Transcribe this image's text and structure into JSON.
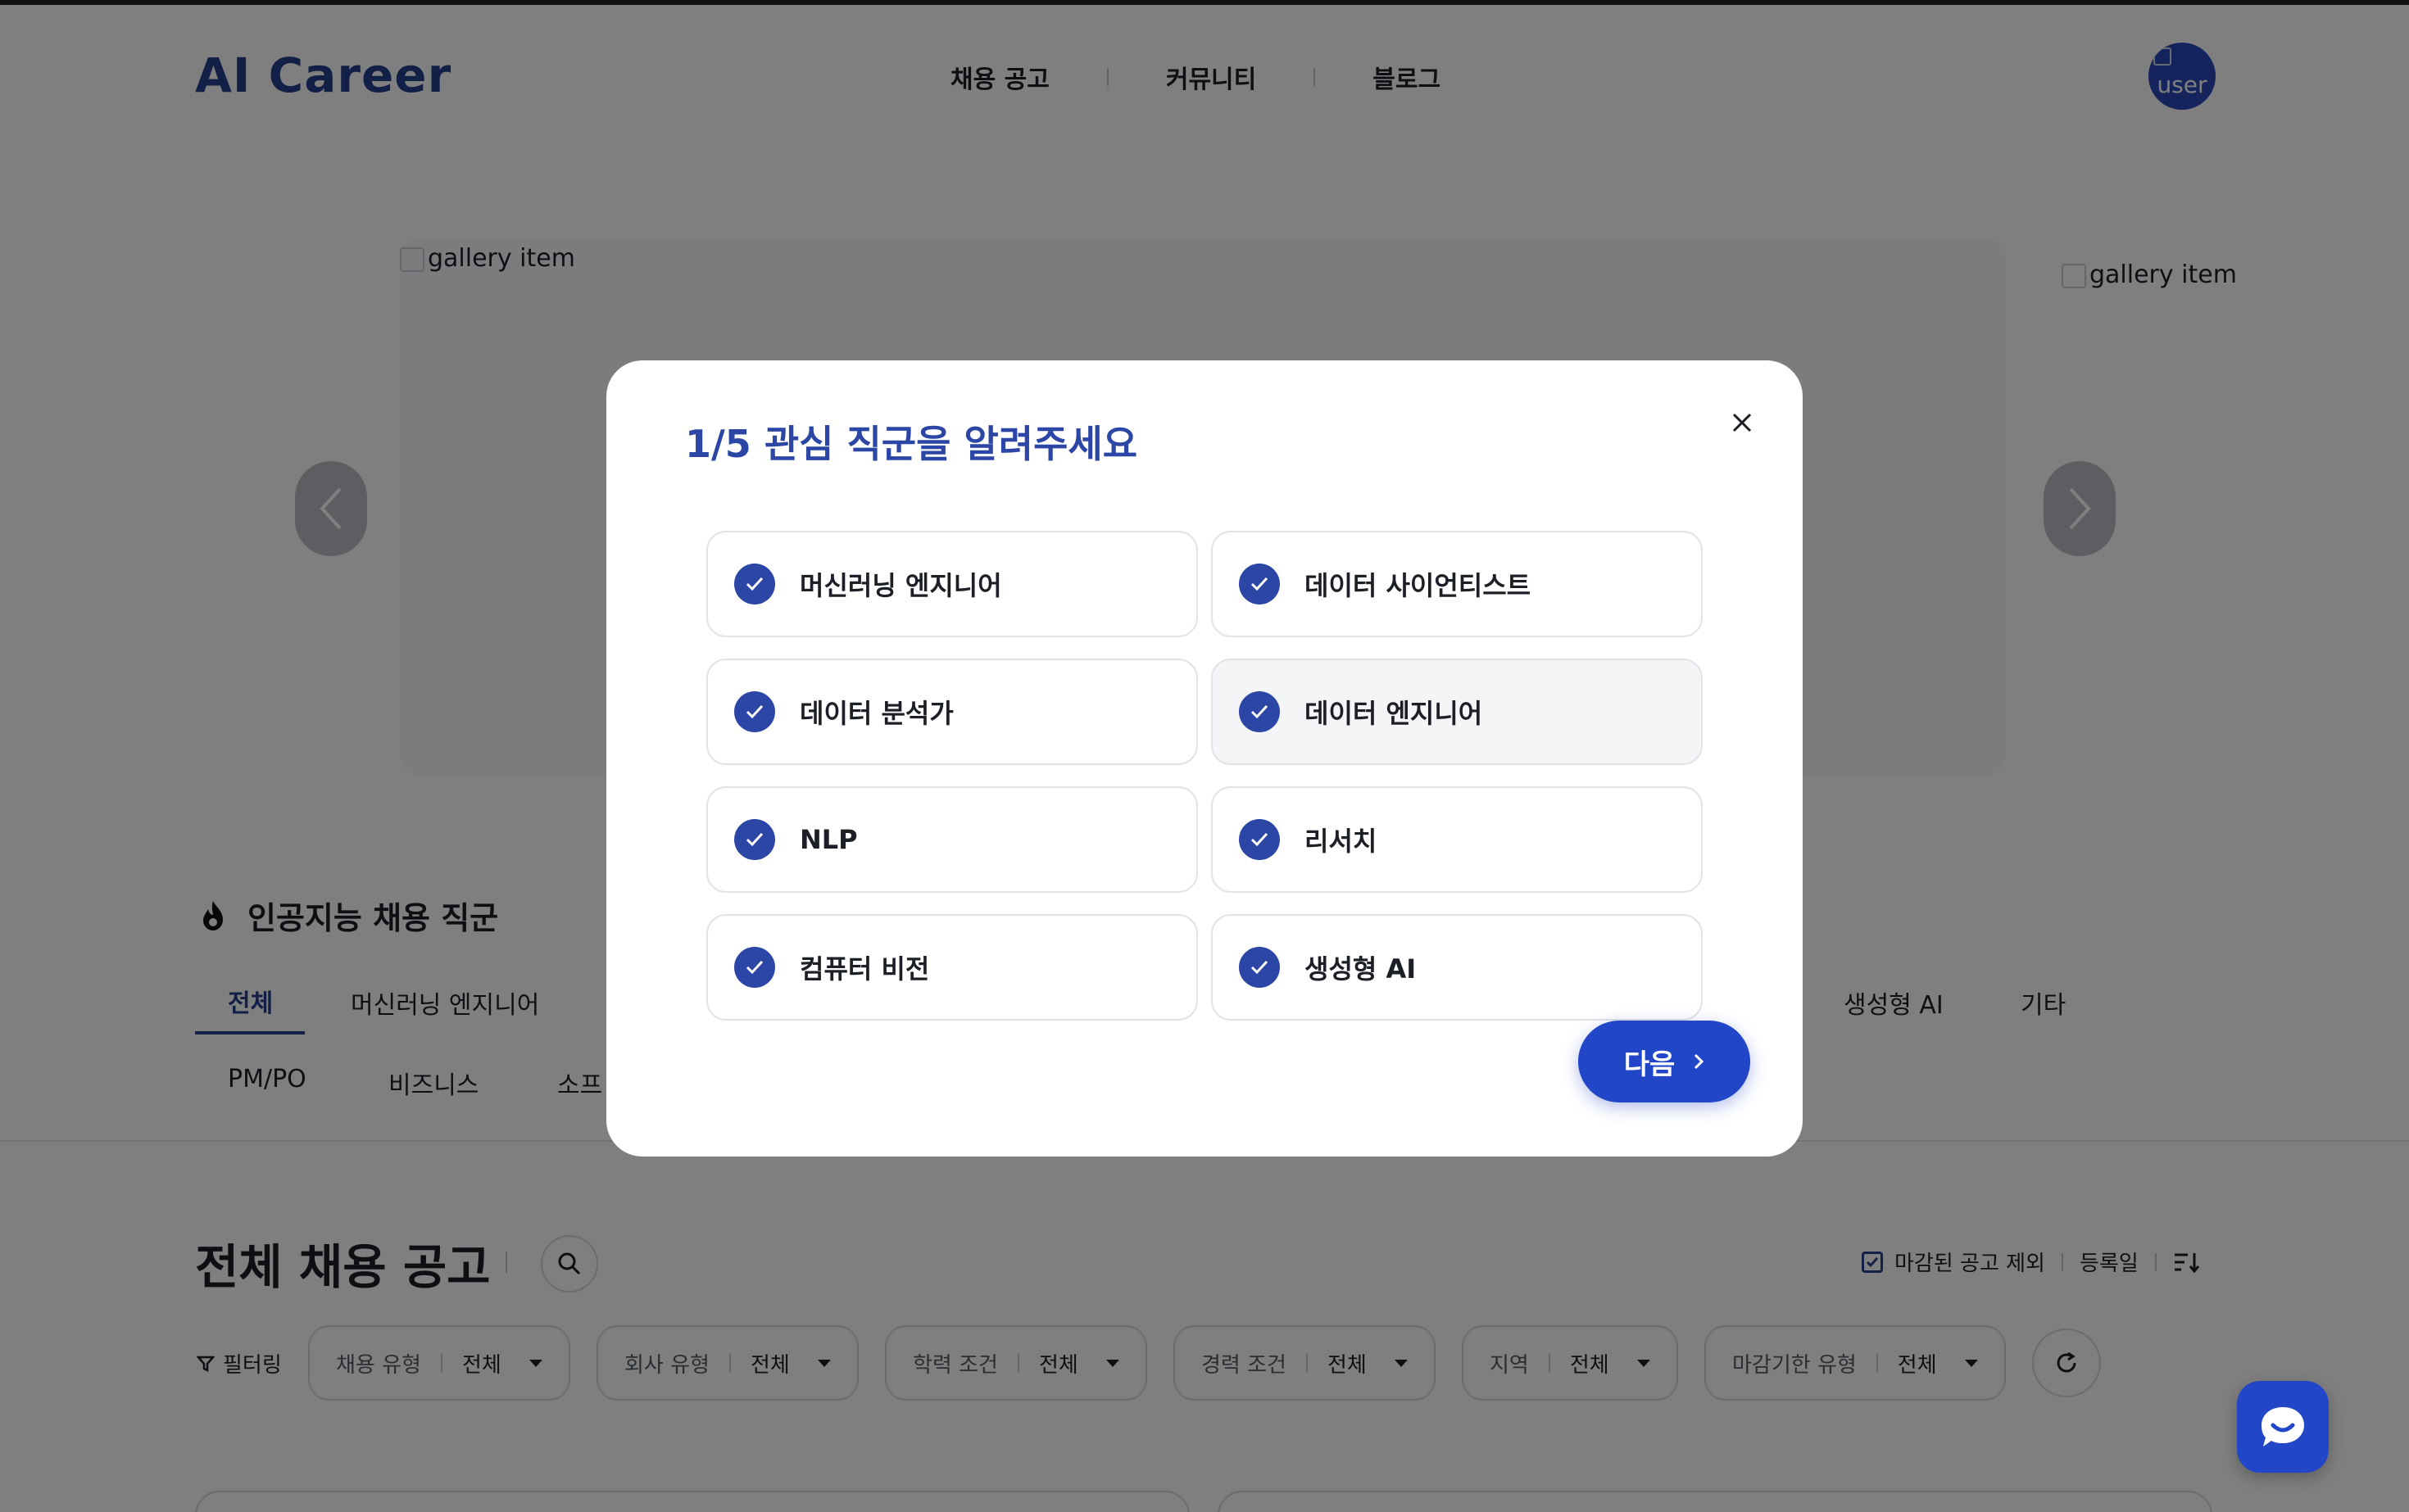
{
  "header": {
    "logo": "AI Career",
    "nav": [
      "채용 공고",
      "커뮤니티",
      "블로그"
    ],
    "avatar_alt": "user"
  },
  "gallery": {
    "main_alt": "gallery item",
    "side_alt": "gallery item",
    "prev_icon": "chevron-left-icon",
    "next_icon": "chevron-right-icon"
  },
  "category": {
    "title": "인공지능 채용 직군",
    "tabs_row1": [
      "전체",
      "머신러닝 엔지니어",
      "생성형 AI",
      "기타"
    ],
    "tabs_row2": [
      "PM/PO",
      "비즈니스",
      "소프"
    ]
  },
  "jobs": {
    "title": "전체 채용 공고",
    "exclude_closed": "마감된 공고 제외",
    "sort_label": "등록일",
    "filter_label": "필터링",
    "filters": [
      {
        "key": "채용 유형",
        "value": "전체"
      },
      {
        "key": "회사 유형",
        "value": "전체"
      },
      {
        "key": "학력 조건",
        "value": "전체"
      },
      {
        "key": "경력 조건",
        "value": "전체"
      },
      {
        "key": "지역",
        "value": "전체"
      },
      {
        "key": "마감기한 유형",
        "value": "전체"
      }
    ]
  },
  "modal": {
    "title": "1/5 관심 직군을 알려주세요",
    "options": [
      {
        "label": "머신러닝 엔지니어",
        "checked": true
      },
      {
        "label": "데이터 사이언티스트",
        "checked": true
      },
      {
        "label": "데이터 분석가",
        "checked": true
      },
      {
        "label": "데이터 엔지니어",
        "checked": true
      },
      {
        "label": "NLP",
        "checked": true
      },
      {
        "label": "리서치",
        "checked": true
      },
      {
        "label": "컴퓨터 비전",
        "checked": true
      },
      {
        "label": "생성형 AI",
        "checked": true
      }
    ],
    "next_label": "다음"
  },
  "colors": {
    "brand": "#24408f",
    "accent": "#2146c7",
    "check": "#2c46a6"
  }
}
